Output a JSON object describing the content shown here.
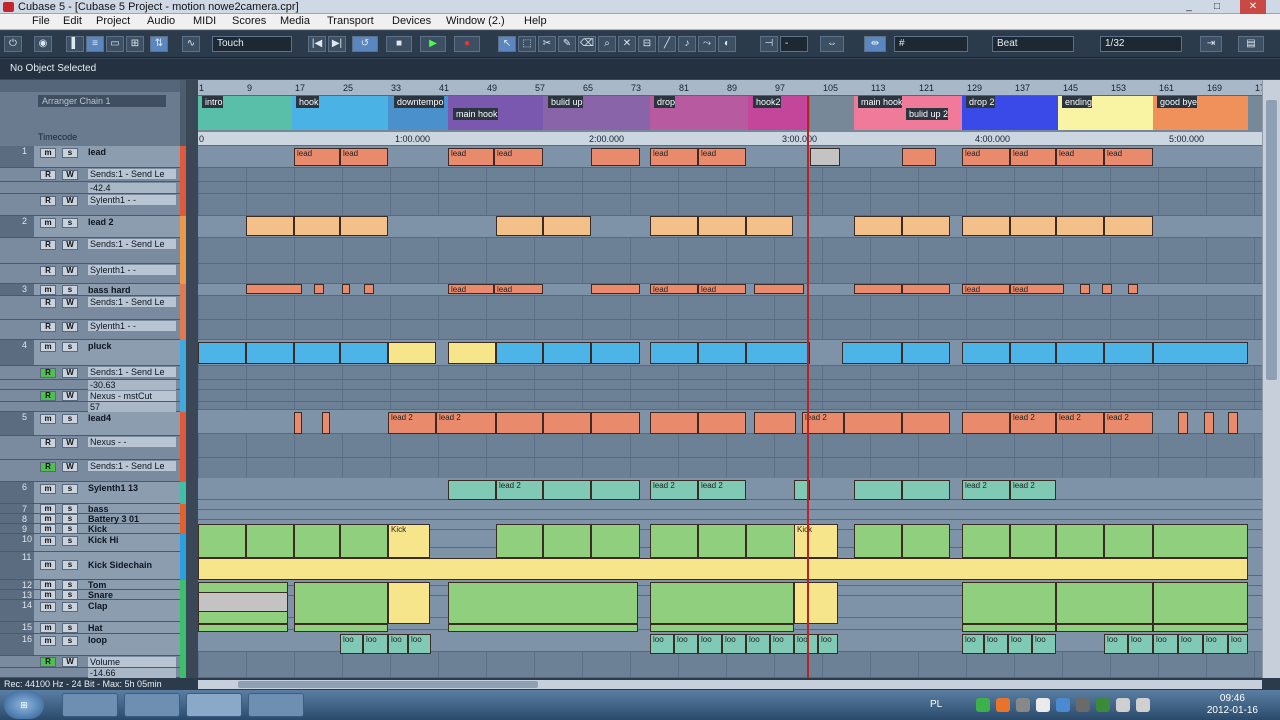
{
  "window": {
    "title": "Cubase 5 - [Cubase 5 Project - motion nowe2camera.cpr]",
    "minimize": "_",
    "maximize": "□",
    "close": "✕"
  },
  "menu": [
    "File",
    "Edit",
    "Project",
    "Audio",
    "MIDI",
    "Scores",
    "Media",
    "Transport",
    "Devices",
    "Window (2.)",
    "Help"
  ],
  "toolbar": {
    "automation_mode": "Touch",
    "snap_type": "Beat",
    "quantize": "1/32",
    "snap_value": "-"
  },
  "info_line": "No Object Selected",
  "inspector": {
    "arranger_chain": "Arranger Chain 1",
    "timecode_label": "Timecode"
  },
  "ruler": [
    "1",
    "9",
    "17",
    "25",
    "33",
    "41",
    "49",
    "57",
    "65",
    "73",
    "81",
    "89",
    "97",
    "105",
    "113",
    "121",
    "129",
    "137",
    "145",
    "153",
    "161",
    "169",
    "17"
  ],
  "timecode": [
    "0",
    "1:00.000",
    "2:00.000",
    "3:00.000",
    "4:00.000",
    "5:00.000"
  ],
  "arranger": [
    "intro",
    "hook",
    "downtempo",
    "main hook",
    "bulid up",
    "drop",
    "hook2",
    "main hook2",
    "bulid up 2",
    "drop 2",
    "ending",
    "good bye"
  ],
  "tracks": [
    {
      "num": "1",
      "name": "lead"
    },
    {
      "name": "Sends:1 - Send Le",
      "value": "-42.4"
    },
    {
      "name": "Sylenth1 - -"
    },
    {
      "num": "2",
      "name": "lead 2"
    },
    {
      "name": "Sends:1 - Send Le"
    },
    {
      "name": "Sylenth1 - -"
    },
    {
      "num": "3",
      "name": "bass hard"
    },
    {
      "name": "Sends:1 - Send Le"
    },
    {
      "name": "Sylenth1 - -"
    },
    {
      "num": "4",
      "name": "pluck"
    },
    {
      "name": "Sends:1 - Send Le",
      "value": "-30.63"
    },
    {
      "name": "Nexus - mstCut",
      "value": "57"
    },
    {
      "num": "5",
      "name": "lead4"
    },
    {
      "name": "Nexus - -"
    },
    {
      "name": "Sends:1 - Send Le"
    },
    {
      "num": "6",
      "name": "Sylenth1 13"
    },
    {
      "num": "7",
      "name": "bass"
    },
    {
      "num": "8",
      "name": "Battery 3 01"
    },
    {
      "num": "9",
      "name": "Kick"
    },
    {
      "num": "10",
      "name": "Kick Hi"
    },
    {
      "num": "11",
      "name": "Kick Sidechain"
    },
    {
      "num": "12",
      "name": "Tom"
    },
    {
      "num": "13",
      "name": "Snare"
    },
    {
      "num": "14",
      "name": "Clap"
    },
    {
      "num": "15",
      "name": "Hat"
    },
    {
      "num": "16",
      "name": "loop"
    },
    {
      "name": "Volume",
      "value": "-14.66"
    }
  ],
  "part_labels": {
    "lead": "lead",
    "lead2": "lead 2",
    "kick": "Kick",
    "k": "K",
    "loop": "loo"
  },
  "btn": {
    "m": "m",
    "s": "s",
    "r": "R",
    "w": "W"
  },
  "status": "Rec: 44100 Hz - 24 Bit - Max: 5h 05min",
  "taskbar": {
    "lang": "PL",
    "time": "09:46",
    "date": "2012-01-16"
  }
}
